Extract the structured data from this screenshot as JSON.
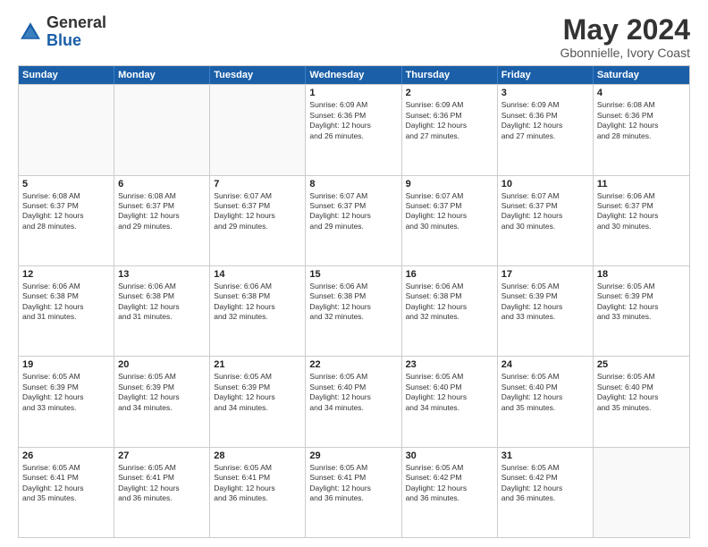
{
  "logo": {
    "general": "General",
    "blue": "Blue"
  },
  "header": {
    "month": "May 2024",
    "location": "Gbonnielle, Ivory Coast"
  },
  "weekdays": [
    "Sunday",
    "Monday",
    "Tuesday",
    "Wednesday",
    "Thursday",
    "Friday",
    "Saturday"
  ],
  "rows": [
    [
      {
        "day": "",
        "lines": []
      },
      {
        "day": "",
        "lines": []
      },
      {
        "day": "",
        "lines": []
      },
      {
        "day": "1",
        "lines": [
          "Sunrise: 6:09 AM",
          "Sunset: 6:36 PM",
          "Daylight: 12 hours",
          "and 26 minutes."
        ]
      },
      {
        "day": "2",
        "lines": [
          "Sunrise: 6:09 AM",
          "Sunset: 6:36 PM",
          "Daylight: 12 hours",
          "and 27 minutes."
        ]
      },
      {
        "day": "3",
        "lines": [
          "Sunrise: 6:09 AM",
          "Sunset: 6:36 PM",
          "Daylight: 12 hours",
          "and 27 minutes."
        ]
      },
      {
        "day": "4",
        "lines": [
          "Sunrise: 6:08 AM",
          "Sunset: 6:36 PM",
          "Daylight: 12 hours",
          "and 28 minutes."
        ]
      }
    ],
    [
      {
        "day": "5",
        "lines": [
          "Sunrise: 6:08 AM",
          "Sunset: 6:37 PM",
          "Daylight: 12 hours",
          "and 28 minutes."
        ]
      },
      {
        "day": "6",
        "lines": [
          "Sunrise: 6:08 AM",
          "Sunset: 6:37 PM",
          "Daylight: 12 hours",
          "and 29 minutes."
        ]
      },
      {
        "day": "7",
        "lines": [
          "Sunrise: 6:07 AM",
          "Sunset: 6:37 PM",
          "Daylight: 12 hours",
          "and 29 minutes."
        ]
      },
      {
        "day": "8",
        "lines": [
          "Sunrise: 6:07 AM",
          "Sunset: 6:37 PM",
          "Daylight: 12 hours",
          "and 29 minutes."
        ]
      },
      {
        "day": "9",
        "lines": [
          "Sunrise: 6:07 AM",
          "Sunset: 6:37 PM",
          "Daylight: 12 hours",
          "and 30 minutes."
        ]
      },
      {
        "day": "10",
        "lines": [
          "Sunrise: 6:07 AM",
          "Sunset: 6:37 PM",
          "Daylight: 12 hours",
          "and 30 minutes."
        ]
      },
      {
        "day": "11",
        "lines": [
          "Sunrise: 6:06 AM",
          "Sunset: 6:37 PM",
          "Daylight: 12 hours",
          "and 30 minutes."
        ]
      }
    ],
    [
      {
        "day": "12",
        "lines": [
          "Sunrise: 6:06 AM",
          "Sunset: 6:38 PM",
          "Daylight: 12 hours",
          "and 31 minutes."
        ]
      },
      {
        "day": "13",
        "lines": [
          "Sunrise: 6:06 AM",
          "Sunset: 6:38 PM",
          "Daylight: 12 hours",
          "and 31 minutes."
        ]
      },
      {
        "day": "14",
        "lines": [
          "Sunrise: 6:06 AM",
          "Sunset: 6:38 PM",
          "Daylight: 12 hours",
          "and 32 minutes."
        ]
      },
      {
        "day": "15",
        "lines": [
          "Sunrise: 6:06 AM",
          "Sunset: 6:38 PM",
          "Daylight: 12 hours",
          "and 32 minutes."
        ]
      },
      {
        "day": "16",
        "lines": [
          "Sunrise: 6:06 AM",
          "Sunset: 6:38 PM",
          "Daylight: 12 hours",
          "and 32 minutes."
        ]
      },
      {
        "day": "17",
        "lines": [
          "Sunrise: 6:05 AM",
          "Sunset: 6:39 PM",
          "Daylight: 12 hours",
          "and 33 minutes."
        ]
      },
      {
        "day": "18",
        "lines": [
          "Sunrise: 6:05 AM",
          "Sunset: 6:39 PM",
          "Daylight: 12 hours",
          "and 33 minutes."
        ]
      }
    ],
    [
      {
        "day": "19",
        "lines": [
          "Sunrise: 6:05 AM",
          "Sunset: 6:39 PM",
          "Daylight: 12 hours",
          "and 33 minutes."
        ]
      },
      {
        "day": "20",
        "lines": [
          "Sunrise: 6:05 AM",
          "Sunset: 6:39 PM",
          "Daylight: 12 hours",
          "and 34 minutes."
        ]
      },
      {
        "day": "21",
        "lines": [
          "Sunrise: 6:05 AM",
          "Sunset: 6:39 PM",
          "Daylight: 12 hours",
          "and 34 minutes."
        ]
      },
      {
        "day": "22",
        "lines": [
          "Sunrise: 6:05 AM",
          "Sunset: 6:40 PM",
          "Daylight: 12 hours",
          "and 34 minutes."
        ]
      },
      {
        "day": "23",
        "lines": [
          "Sunrise: 6:05 AM",
          "Sunset: 6:40 PM",
          "Daylight: 12 hours",
          "and 34 minutes."
        ]
      },
      {
        "day": "24",
        "lines": [
          "Sunrise: 6:05 AM",
          "Sunset: 6:40 PM",
          "Daylight: 12 hours",
          "and 35 minutes."
        ]
      },
      {
        "day": "25",
        "lines": [
          "Sunrise: 6:05 AM",
          "Sunset: 6:40 PM",
          "Daylight: 12 hours",
          "and 35 minutes."
        ]
      }
    ],
    [
      {
        "day": "26",
        "lines": [
          "Sunrise: 6:05 AM",
          "Sunset: 6:41 PM",
          "Daylight: 12 hours",
          "and 35 minutes."
        ]
      },
      {
        "day": "27",
        "lines": [
          "Sunrise: 6:05 AM",
          "Sunset: 6:41 PM",
          "Daylight: 12 hours",
          "and 36 minutes."
        ]
      },
      {
        "day": "28",
        "lines": [
          "Sunrise: 6:05 AM",
          "Sunset: 6:41 PM",
          "Daylight: 12 hours",
          "and 36 minutes."
        ]
      },
      {
        "day": "29",
        "lines": [
          "Sunrise: 6:05 AM",
          "Sunset: 6:41 PM",
          "Daylight: 12 hours",
          "and 36 minutes."
        ]
      },
      {
        "day": "30",
        "lines": [
          "Sunrise: 6:05 AM",
          "Sunset: 6:42 PM",
          "Daylight: 12 hours",
          "and 36 minutes."
        ]
      },
      {
        "day": "31",
        "lines": [
          "Sunrise: 6:05 AM",
          "Sunset: 6:42 PM",
          "Daylight: 12 hours",
          "and 36 minutes."
        ]
      },
      {
        "day": "",
        "lines": []
      }
    ]
  ]
}
